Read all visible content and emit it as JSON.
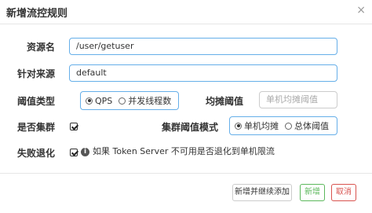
{
  "dialog": {
    "title": "新增流控规则",
    "close_glyph": "×"
  },
  "form": {
    "resource_label": "资源名",
    "resource_value": "/user/getuser",
    "origin_label": "针对来源",
    "origin_value": "default",
    "threshold_type_label": "阈值类型",
    "threshold_type_options": [
      "QPS",
      "并发线程数"
    ],
    "threshold_type_selected": "QPS",
    "avg_threshold_label": "均摊阈值",
    "avg_threshold_placeholder": "单机均摊阈值",
    "cluster_label": "是否集群",
    "cluster_checked": true,
    "cluster_mode_label": "集群阈值模式",
    "cluster_mode_options": [
      "单机均摊",
      "总体阈值"
    ],
    "cluster_mode_selected": "单机均摊",
    "fallback_label": "失败退化",
    "fallback_checked": true,
    "fallback_text": "如果 Token Server 不可用是否退化到单机限流"
  },
  "footer": {
    "add_continue_label": "新增并继续添加",
    "add_label": "新增",
    "cancel_label": "取消"
  },
  "colors": {
    "focus_border": "#66afe9",
    "add": "#5cb85c",
    "cancel": "#d9534f"
  }
}
